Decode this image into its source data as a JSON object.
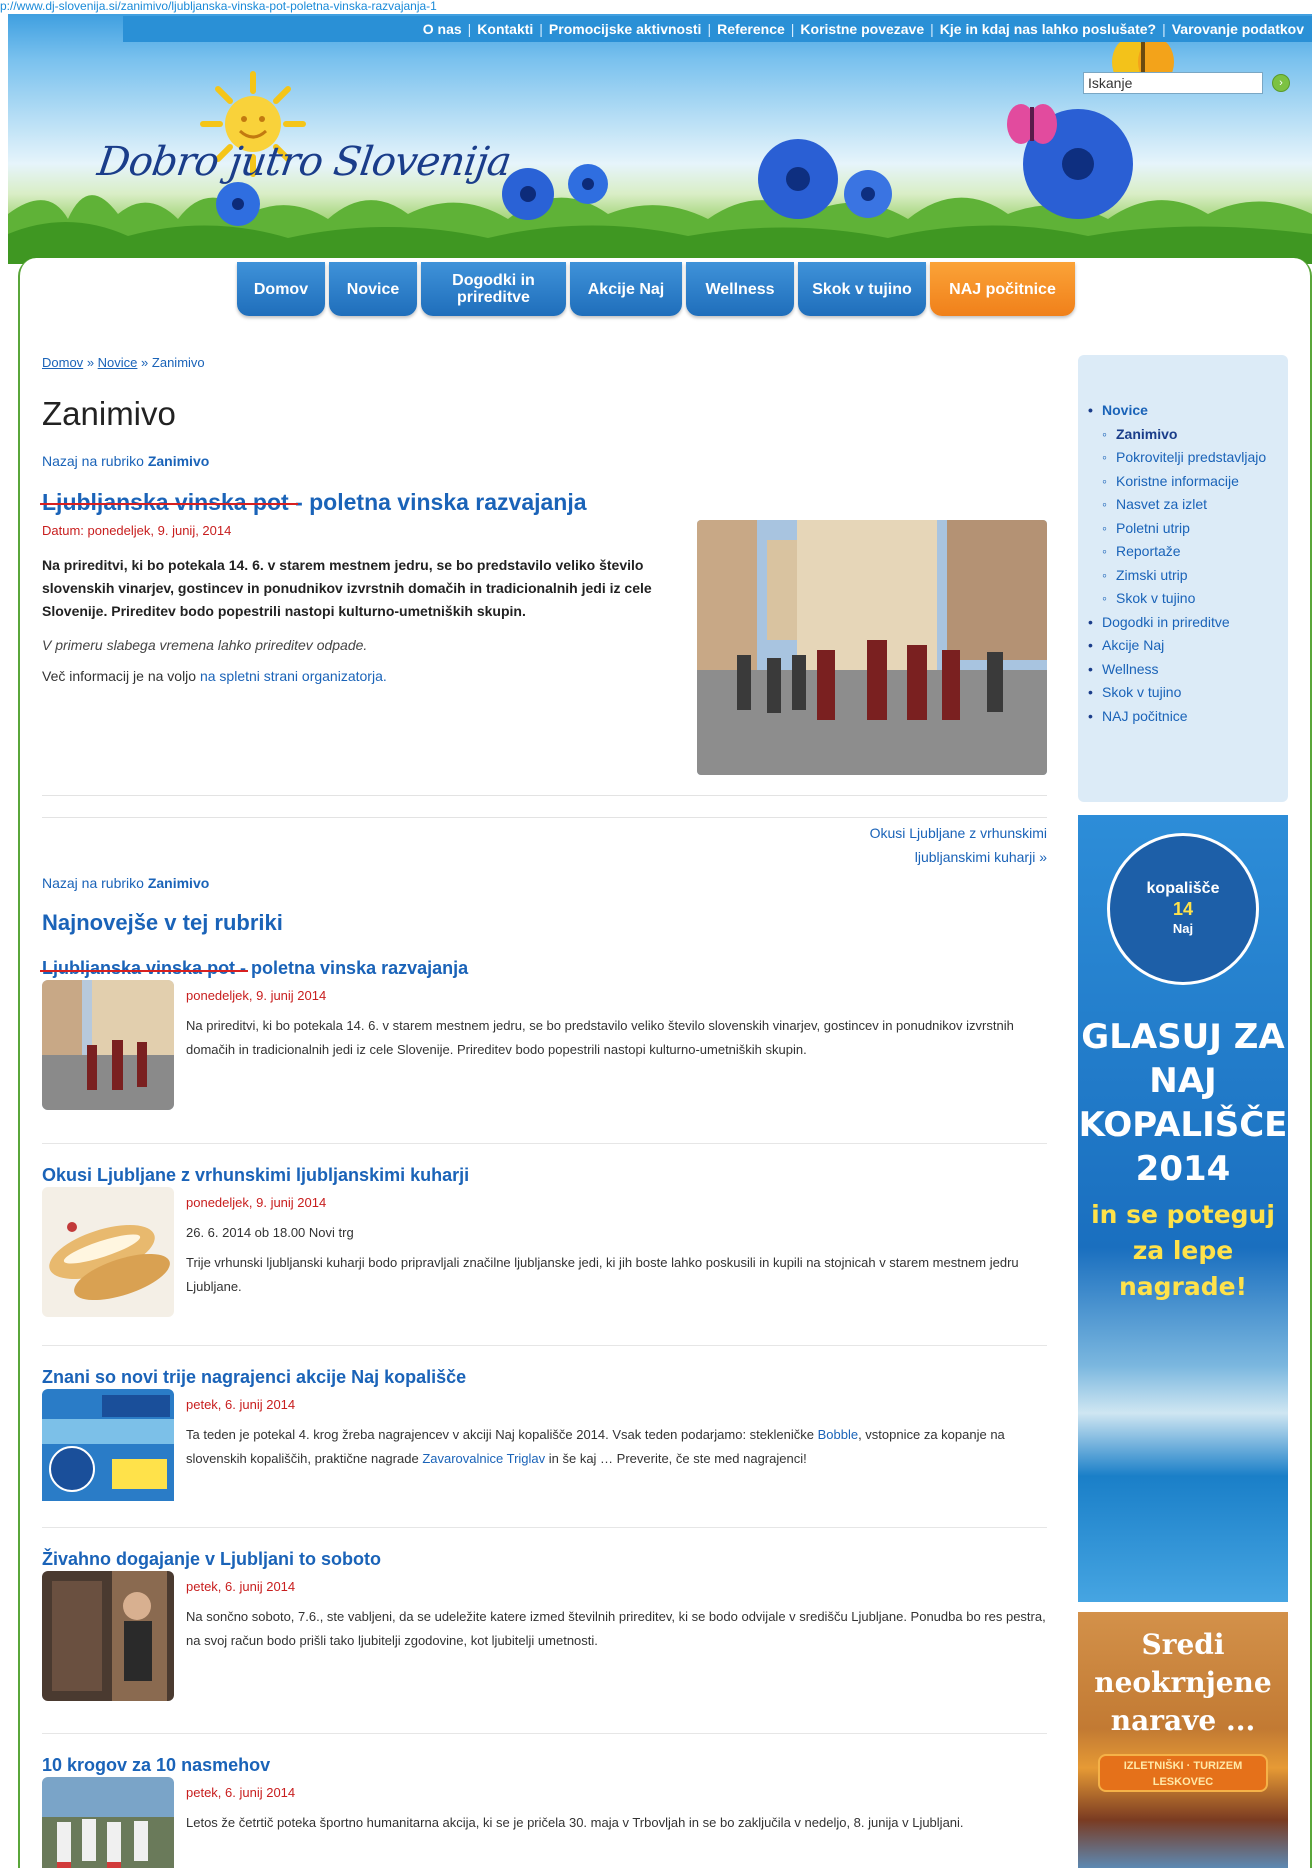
{
  "url": "p://www.dj-slovenija.si/zanimivo/ljubljanska-vinska-pot-poletna-vinska-razvajanja-1",
  "topnav": [
    "O nas",
    "Kontakti",
    "Promocijske aktivnosti",
    "Reference",
    "Koristne povezave",
    "Kje in kdaj nas lahko poslušate?",
    "Varovanje podatkov"
  ],
  "logo_text": "Dobro jutro Slovenija",
  "search": {
    "value": "Iskanje"
  },
  "mainnav": [
    "Domov",
    "Novice",
    "Dogodki in prireditve",
    "Akcije Naj",
    "Wellness",
    "Skok v tujino",
    "NAJ počitnice"
  ],
  "breadcrumb": {
    "home": "Domov",
    "sep": "»",
    "news": "Novice",
    "current": "Zanimivo"
  },
  "page_title": "Zanimivo",
  "back": {
    "text": "Nazaj na rubriko",
    "category": "Zanimivo"
  },
  "article": {
    "title_part1": "Ljubljanska vinska pot",
    "title_part2": " - poletna vinska razvajanja",
    "date": "Datum: ponedeljek, 9. junij, 2014",
    "lead": "Na prireditvi, ki bo potekala 14. 6. v starem mestnem jedru, se bo predstavilo veliko število slovenskih vinarjev, gostincev in ponudnikov izvrstnih domačih in tradicionalnih jedi iz cele Slovenije. Prireditev bodo popestrili nastopi kulturno-umetniških skupin.",
    "note": "V primeru slabega vremena lahko prireditev odpade.",
    "more_text": "Več informacij je na voljo",
    "more_link": "na spletni strani organizatorja."
  },
  "next_link": {
    "line1": "Okusi Ljubljane z vrhunskimi",
    "line2": "ljubljanskimi kuharji »"
  },
  "latest_title": "Najnovejše v tej rubriki",
  "items": [
    {
      "title": "Ljubljanska vinska pot - poletna vinska razvajanja",
      "date": "ponedeljek, 9. junij 2014",
      "p1": "Na prireditvi, ki bo potekala 14. 6. v starem mestnem jedru, se bo predstavilo veliko število slovenskih vinarjev, gostincev in ponudnikov izvrstnih domačih in tradicionalnih jedi iz cele Slovenije. Prireditev bodo popestrili nastopi kulturno-umetniških skupin.",
      "p2": ""
    },
    {
      "title": "Okusi Ljubljane z vrhunskimi ljubljanskimi kuharji",
      "date": "ponedeljek, 9. junij 2014",
      "p1": "26. 6. 2014 ob 18.00 Novi trg",
      "p2": "Trije vrhunski ljubljanski kuharji bodo pripravljali značilne ljubljanske jedi, ki jih boste lahko poskusili in kupili na stojnicah v starem mestnem jedru Ljubljane."
    },
    {
      "title": "Znani so novi trije nagrajenci akcije Naj kopališče",
      "date": "petek, 6. junij 2014",
      "p1a": "Ta teden je potekal 4. krog žreba nagrajencev v akciji Naj kopališče 2014. Vsak teden podarjamo: stekleničke ",
      "p1link1": "Bobble",
      "p1b": ", vstopnice za kopanje na slovenskih kopališčih, praktične nagrade ",
      "p1link2": "Zavarovalnice Triglav",
      "p1c": " in še kaj … Preverite, če ste med nagrajenci!"
    },
    {
      "title": "Živahno dogajanje v Ljubljani to soboto",
      "date": "petek, 6. junij 2014",
      "p1": "Na sončno soboto, 7.6., ste vabljeni, da se udeležite katere izmed številnih prireditev, ki se bodo odvijale v središču Ljubljane. Ponudba bo res pestra, na svoj račun bodo prišli tako ljubitelji zgodovine, kot ljubitelji umetnosti.",
      "p2": ""
    },
    {
      "title": "10 krogov za 10 nasmehov",
      "date": "petek, 6. junij 2014",
      "p1": "Letos že četrtič poteka športno humanitarna akcija, ki se je pričela 30. maja v Trbovljah in se bo zaključila v nedeljo, 8. junija v Ljubljani.",
      "p2": ""
    }
  ],
  "sidebar": {
    "novice": "Novice",
    "subs": [
      "Zanimivo",
      "Pokrovitelji predstavljajo",
      "Koristne informacije",
      "Nasvet za izlet",
      "Poletni utrip",
      "Reportaže",
      "Zimski utrip",
      "Skok v tujino"
    ],
    "others": [
      "Dogodki in prireditve",
      "Akcije Naj",
      "Wellness",
      "Skok v tujino",
      "NAJ počitnice"
    ]
  },
  "ad1": {
    "logo": "kopališče",
    "logo_num": "14",
    "logo_sub": "Naj",
    "h1": "GLASUJ ZA",
    "h2": "NAJ",
    "h3": "KOPALIŠČE",
    "h4": "2014",
    "s1": "in se poteguj",
    "s2": "za lepe",
    "s3": "nagrade!"
  },
  "ad2": {
    "t1": "Sredi",
    "t2": "neokrnjene",
    "t3": "narave ...",
    "badge1": "IZLETNIŠKI · TURIZEM",
    "badge2": "LESKOVEC"
  }
}
